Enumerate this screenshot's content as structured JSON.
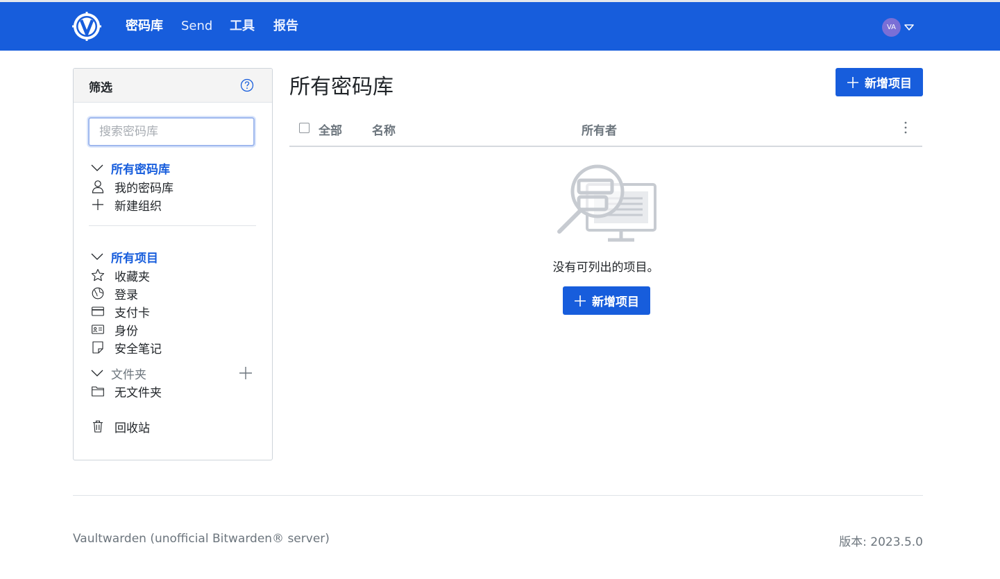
{
  "nav": {
    "links": [
      "密码库",
      "Send",
      "工具",
      "报告"
    ],
    "avatar_initials": "VA"
  },
  "sidebar": {
    "title": "筛选",
    "search_placeholder": "搜索密码库",
    "vaults_header": "所有密码库",
    "my_vault": "我的密码库",
    "new_org": "新建组织",
    "items_header": "所有项目",
    "favorites": "收藏夹",
    "login": "登录",
    "card": "支付卡",
    "identity": "身份",
    "secure_note": "安全笔记",
    "folders_header": "文件夹",
    "no_folder": "无文件夹",
    "trash": "回收站"
  },
  "main": {
    "title": "所有密码库",
    "new_item_label": "新增项目",
    "columns": {
      "all": "全部",
      "name": "名称",
      "owner": "所有者"
    },
    "empty_text": "没有可列出的项目。",
    "empty_new_item_label": "新增项目"
  },
  "footer": {
    "left": "Vaultwarden (unofficial Bitwarden® server)",
    "right": "版本: 2023.5.0"
  },
  "colors": {
    "brand": "#175ddc",
    "avatar": "#7a6fd6"
  },
  "icons": {
    "logo": "vaultwarden-logo",
    "help": "question-circle-icon",
    "my_vault": "user-icon",
    "new_org": "plus-icon",
    "favorites": "star-icon",
    "login": "globe-icon",
    "card": "credit-card-icon",
    "identity": "id-card-icon",
    "secure_note": "sticky-note-icon",
    "folder": "folder-icon",
    "trash": "trash-icon"
  }
}
